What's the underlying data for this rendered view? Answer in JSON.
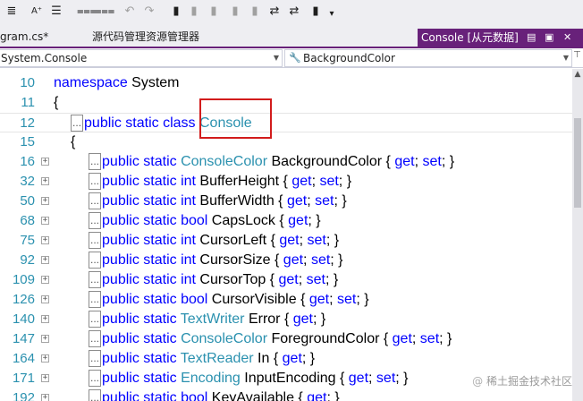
{
  "toolbar": {
    "icons": [
      "align-left-icon",
      "font-icon",
      "format-icon",
      "comment-icon",
      "uncomment-icon",
      "undo-icon",
      "redo-icon",
      "bookmark-icon",
      "bookmark-prev-icon",
      "bookmark-next-icon",
      "bookmark-clear-icon",
      "bookmark-folder-icon",
      "bookmark-folder-prev-icon",
      "bookmark-folder-next-icon",
      "bookmark-clear-all-icon",
      "more-icon"
    ]
  },
  "tabs": {
    "file_tab": "gram.cs*",
    "source_tab": "源代码管理资源管理器",
    "active": {
      "label": "Console [从元数据]",
      "pin_icon": "pin-icon",
      "close_icon": "close-icon"
    }
  },
  "navbar": {
    "type_combo": "System.Console",
    "member_combo": "BackgroundColor",
    "member_icon": "wrench-icon",
    "split_icon": "split-icon"
  },
  "editor": {
    "lines": [
      {
        "num": "10",
        "fold": "",
        "ellipsis": false,
        "indent": 60,
        "parts": [
          [
            "kw",
            "namespace"
          ],
          [
            "",
            " System"
          ]
        ]
      },
      {
        "num": "11",
        "fold": "",
        "ellipsis": false,
        "indent": 60,
        "parts": [
          [
            "",
            "{"
          ]
        ]
      },
      {
        "num": "12",
        "fold": "",
        "ellipsis": true,
        "indent": 79,
        "current": true,
        "parts": [
          [
            "kw",
            "public"
          ],
          [
            "",
            " "
          ],
          [
            "kw",
            "static"
          ],
          [
            "",
            " "
          ],
          [
            "kw",
            "class"
          ],
          [
            "",
            " "
          ],
          [
            "ty",
            "Console"
          ]
        ]
      },
      {
        "num": "15",
        "fold": "",
        "ellipsis": false,
        "indent": 79,
        "parts": [
          [
            "",
            "{"
          ]
        ]
      },
      {
        "num": "16",
        "fold": "+",
        "ellipsis": true,
        "indent": 99,
        "parts": [
          [
            "kw",
            "public"
          ],
          [
            "",
            " "
          ],
          [
            "kw",
            "static"
          ],
          [
            "",
            " "
          ],
          [
            "ty",
            "ConsoleColor"
          ],
          [
            "",
            " BackgroundColor { "
          ],
          [
            "kw",
            "get"
          ],
          [
            "",
            "; "
          ],
          [
            "kw",
            "set"
          ],
          [
            "",
            "; }"
          ]
        ]
      },
      {
        "num": "32",
        "fold": "+",
        "ellipsis": true,
        "indent": 99,
        "parts": [
          [
            "kw",
            "public"
          ],
          [
            "",
            " "
          ],
          [
            "kw",
            "static"
          ],
          [
            "",
            " "
          ],
          [
            "kw",
            "int"
          ],
          [
            "",
            " BufferHeight { "
          ],
          [
            "kw",
            "get"
          ],
          [
            "",
            "; "
          ],
          [
            "kw",
            "set"
          ],
          [
            "",
            "; }"
          ]
        ]
      },
      {
        "num": "50",
        "fold": "+",
        "ellipsis": true,
        "indent": 99,
        "parts": [
          [
            "kw",
            "public"
          ],
          [
            "",
            " "
          ],
          [
            "kw",
            "static"
          ],
          [
            "",
            " "
          ],
          [
            "kw",
            "int"
          ],
          [
            "",
            " BufferWidth { "
          ],
          [
            "kw",
            "get"
          ],
          [
            "",
            "; "
          ],
          [
            "kw",
            "set"
          ],
          [
            "",
            "; }"
          ]
        ]
      },
      {
        "num": "68",
        "fold": "+",
        "ellipsis": true,
        "indent": 99,
        "parts": [
          [
            "kw",
            "public"
          ],
          [
            "",
            " "
          ],
          [
            "kw",
            "static"
          ],
          [
            "",
            " "
          ],
          [
            "kw",
            "bool"
          ],
          [
            "",
            " CapsLock { "
          ],
          [
            "kw",
            "get"
          ],
          [
            "",
            "; }"
          ]
        ]
      },
      {
        "num": "75",
        "fold": "+",
        "ellipsis": true,
        "indent": 99,
        "parts": [
          [
            "kw",
            "public"
          ],
          [
            "",
            " "
          ],
          [
            "kw",
            "static"
          ],
          [
            "",
            " "
          ],
          [
            "kw",
            "int"
          ],
          [
            "",
            " CursorLeft { "
          ],
          [
            "kw",
            "get"
          ],
          [
            "",
            "; "
          ],
          [
            "kw",
            "set"
          ],
          [
            "",
            "; }"
          ]
        ]
      },
      {
        "num": "92",
        "fold": "+",
        "ellipsis": true,
        "indent": 99,
        "parts": [
          [
            "kw",
            "public"
          ],
          [
            "",
            " "
          ],
          [
            "kw",
            "static"
          ],
          [
            "",
            " "
          ],
          [
            "kw",
            "int"
          ],
          [
            "",
            " CursorSize { "
          ],
          [
            "kw",
            "get"
          ],
          [
            "",
            "; "
          ],
          [
            "kw",
            "set"
          ],
          [
            "",
            "; }"
          ]
        ]
      },
      {
        "num": "109",
        "fold": "+",
        "ellipsis": true,
        "indent": 99,
        "parts": [
          [
            "kw",
            "public"
          ],
          [
            "",
            " "
          ],
          [
            "kw",
            "static"
          ],
          [
            "",
            " "
          ],
          [
            "kw",
            "int"
          ],
          [
            "",
            " CursorTop { "
          ],
          [
            "kw",
            "get"
          ],
          [
            "",
            "; "
          ],
          [
            "kw",
            "set"
          ],
          [
            "",
            "; }"
          ]
        ]
      },
      {
        "num": "126",
        "fold": "+",
        "ellipsis": true,
        "indent": 99,
        "parts": [
          [
            "kw",
            "public"
          ],
          [
            "",
            " "
          ],
          [
            "kw",
            "static"
          ],
          [
            "",
            " "
          ],
          [
            "kw",
            "bool"
          ],
          [
            "",
            " CursorVisible { "
          ],
          [
            "kw",
            "get"
          ],
          [
            "",
            "; "
          ],
          [
            "kw",
            "set"
          ],
          [
            "",
            "; }"
          ]
        ]
      },
      {
        "num": "140",
        "fold": "+",
        "ellipsis": true,
        "indent": 99,
        "parts": [
          [
            "kw",
            "public"
          ],
          [
            "",
            " "
          ],
          [
            "kw",
            "static"
          ],
          [
            "",
            " "
          ],
          [
            "ty",
            "TextWriter"
          ],
          [
            "",
            " Error { "
          ],
          [
            "kw",
            "get"
          ],
          [
            "",
            "; }"
          ]
        ]
      },
      {
        "num": "147",
        "fold": "+",
        "ellipsis": true,
        "indent": 99,
        "parts": [
          [
            "kw",
            "public"
          ],
          [
            "",
            " "
          ],
          [
            "kw",
            "static"
          ],
          [
            "",
            " "
          ],
          [
            "ty",
            "ConsoleColor"
          ],
          [
            "",
            " ForegroundColor { "
          ],
          [
            "kw",
            "get"
          ],
          [
            "",
            "; "
          ],
          [
            "kw",
            "set"
          ],
          [
            "",
            "; }"
          ]
        ]
      },
      {
        "num": "164",
        "fold": "+",
        "ellipsis": true,
        "indent": 99,
        "parts": [
          [
            "kw",
            "public"
          ],
          [
            "",
            " "
          ],
          [
            "kw",
            "static"
          ],
          [
            "",
            " "
          ],
          [
            "ty",
            "TextReader"
          ],
          [
            "",
            " In { "
          ],
          [
            "kw",
            "get"
          ],
          [
            "",
            "; }"
          ]
        ]
      },
      {
        "num": "171",
        "fold": "+",
        "ellipsis": true,
        "indent": 99,
        "parts": [
          [
            "kw",
            "public"
          ],
          [
            "",
            " "
          ],
          [
            "kw",
            "static"
          ],
          [
            "",
            " "
          ],
          [
            "ty",
            "Encoding"
          ],
          [
            "",
            " InputEncoding { "
          ],
          [
            "kw",
            "get"
          ],
          [
            "",
            "; "
          ],
          [
            "kw",
            "set"
          ],
          [
            "",
            "; }"
          ]
        ]
      },
      {
        "num": "192",
        "fold": "+",
        "ellipsis": true,
        "indent": 99,
        "parts": [
          [
            "kw",
            "public"
          ],
          [
            "",
            " "
          ],
          [
            "kw",
            "static"
          ],
          [
            "",
            " "
          ],
          [
            "kw",
            "bool"
          ],
          [
            "",
            " KeyAvailable { "
          ],
          [
            "kw",
            "get"
          ],
          [
            "",
            "; }"
          ]
        ]
      }
    ],
    "ellipsis_text": "..."
  },
  "watermark": {
    "at": "@",
    "text": "稀土掘金技术社区"
  }
}
